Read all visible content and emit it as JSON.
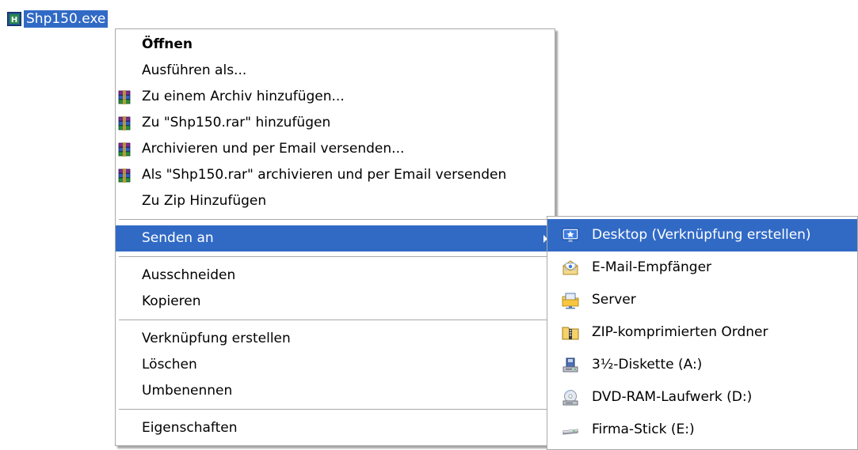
{
  "desktop_file": {
    "name": "Shp150.exe",
    "icon": "exe-program-icon"
  },
  "context_menu": {
    "items": [
      {
        "label": "Öffnen",
        "bold": true
      },
      {
        "label": "Ausführen als..."
      },
      {
        "label": "Zu einem Archiv hinzufügen...",
        "icon": "winrar-icon"
      },
      {
        "label": "Zu \"Shp150.rar\" hinzufügen",
        "icon": "winrar-icon"
      },
      {
        "label": "Archivieren und per Email versenden...",
        "icon": "winrar-icon"
      },
      {
        "label": "Als \"Shp150.rar\" archivieren und per Email versenden",
        "icon": "winrar-icon"
      },
      {
        "label": "Zu Zip Hinzufügen"
      },
      {
        "label": "Senden an",
        "selected": true,
        "has_submenu": true
      },
      {
        "label": "Ausschneiden"
      },
      {
        "label": "Kopieren"
      },
      {
        "label": "Verknüpfung erstellen"
      },
      {
        "label": "Löschen"
      },
      {
        "label": "Umbenennen"
      },
      {
        "label": "Eigenschaften"
      }
    ]
  },
  "send_to_submenu": {
    "items": [
      {
        "label": "Desktop (Verknüpfung erstellen)",
        "icon": "desktop-shortcut-icon",
        "selected": true
      },
      {
        "label": "E-Mail-Empfänger",
        "icon": "mail-recipient-icon"
      },
      {
        "label": "Server",
        "icon": "network-folder-icon"
      },
      {
        "label": "ZIP-komprimierten Ordner",
        "icon": "zip-folder-icon"
      },
      {
        "label": "3½-Diskette (A:)",
        "icon": "floppy-drive-icon"
      },
      {
        "label": "DVD-RAM-Laufwerk (D:)",
        "icon": "dvd-drive-icon"
      },
      {
        "label": "Firma-Stick (E:)",
        "icon": "usb-drive-icon"
      }
    ]
  },
  "colors": {
    "selection": "#316ac5",
    "menu_border": "#a9a9a9"
  }
}
